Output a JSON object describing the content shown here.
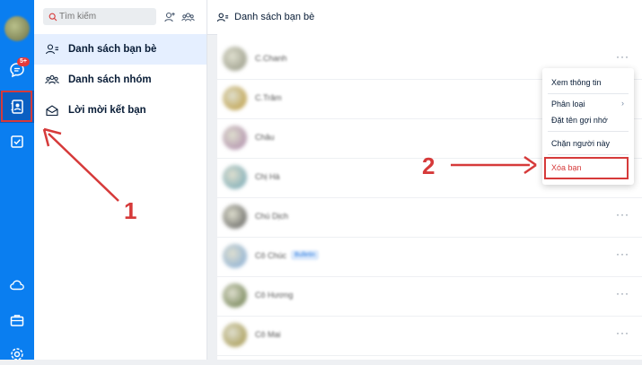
{
  "rail": {
    "chat_badge": "5+"
  },
  "sidebar": {
    "search_placeholder": "Tìm kiếm",
    "items": [
      {
        "label": "Danh sách bạn bè"
      },
      {
        "label": "Danh sách nhóm"
      },
      {
        "label": "Lời mời kết bạn"
      }
    ]
  },
  "main": {
    "title": "Danh sách bạn bè",
    "friends": [
      {
        "name": "C.Chanh",
        "avatar": "#8d8f7c",
        "dots": "···"
      },
      {
        "name": "C.Trâm",
        "avatar": "#b8932e",
        "dots": ""
      },
      {
        "name": "Châu",
        "avatar": "#a77fa5",
        "dots": ""
      },
      {
        "name": "Chị Hà",
        "avatar": "#67a1b2",
        "dots": ""
      },
      {
        "name": "Chú Dịch",
        "avatar": "#4f4f4f",
        "dots": "···"
      },
      {
        "name": "Cô Chúc",
        "avatar": "#7aa6d6",
        "dots": "···",
        "tag": "Bulletin"
      },
      {
        "name": "Cô Hương",
        "avatar": "#5b6f3a",
        "dots": "···"
      },
      {
        "name": "Cô Mai",
        "avatar": "#9c8c3a",
        "dots": "···"
      }
    ]
  },
  "context_menu": {
    "items": [
      "Xem thông tin",
      "Phân loại",
      "Đặt tên gợi nhớ",
      "Chặn người này",
      "Xóa bạn"
    ]
  },
  "annotations": {
    "step1": "1",
    "step2": "2"
  },
  "colors": {
    "accent": "#0a7ef0",
    "annotation_red": "#d63a3a"
  }
}
